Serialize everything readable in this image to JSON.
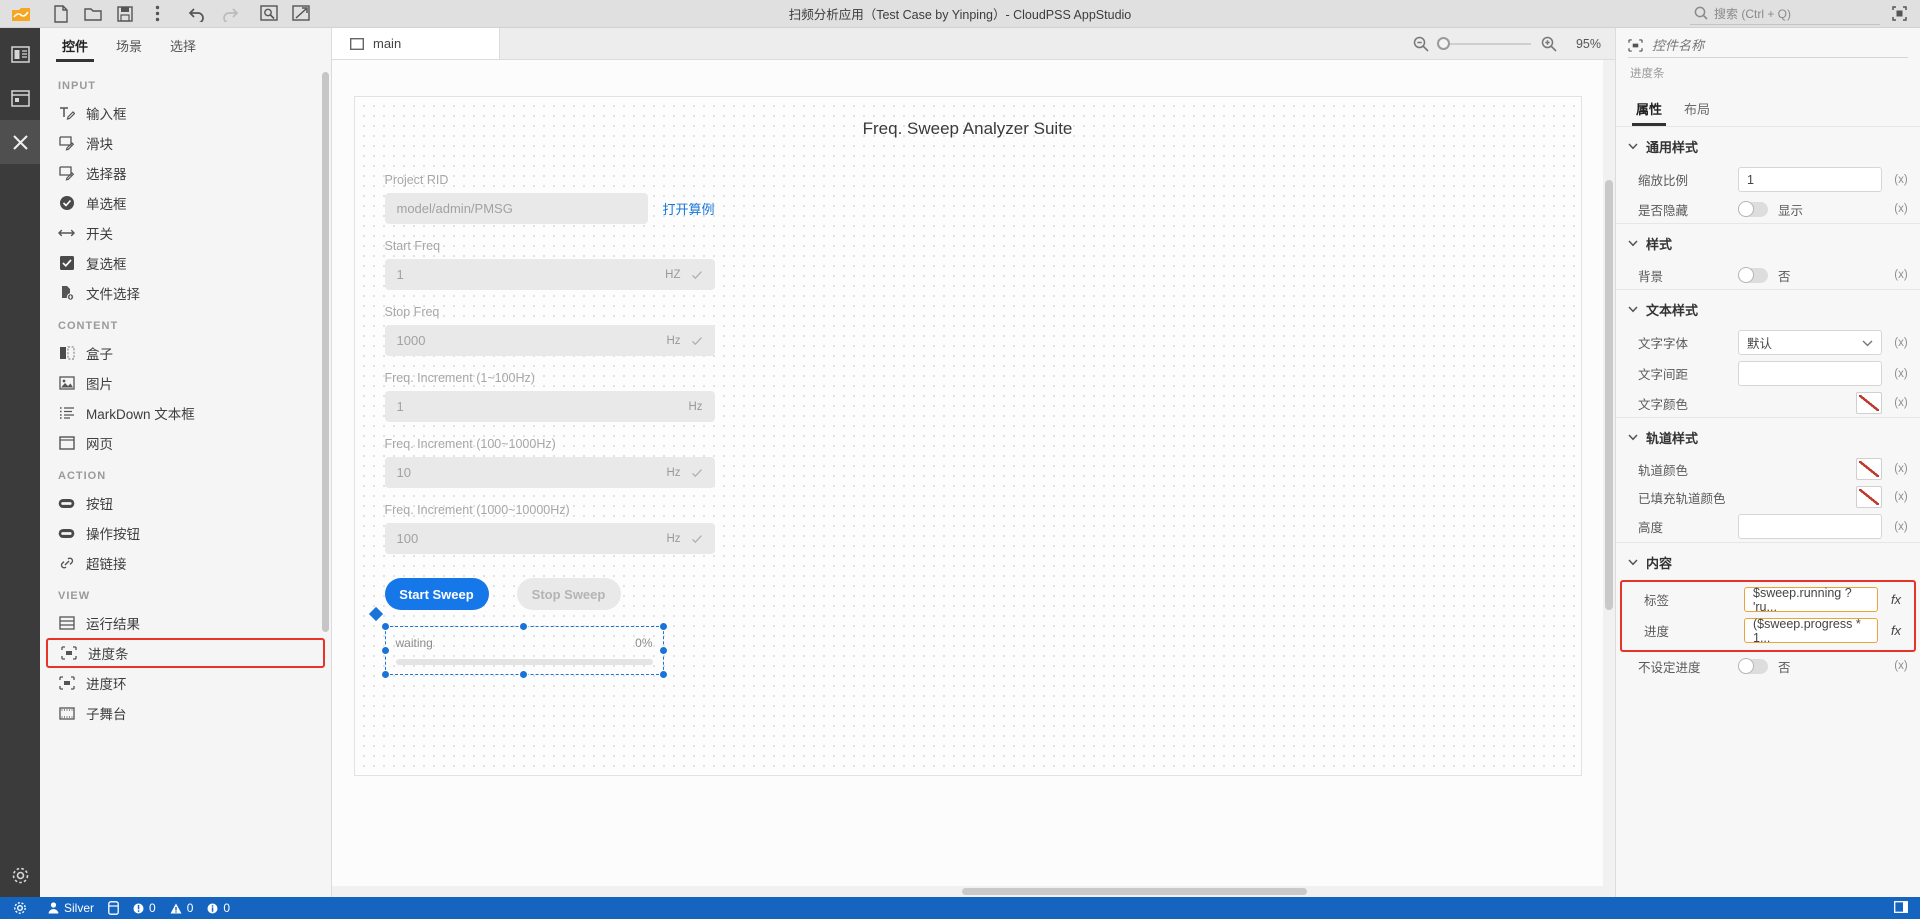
{
  "titlebar": {
    "app_title": "扫频分析应用（Test Case by Yinping）- CloudPSS AppStudio",
    "search_placeholder": "搜索 (Ctrl + Q)",
    "tools": [
      {
        "name": "app-logo-icon",
        "label": "CloudPSS"
      },
      {
        "name": "new-file-icon",
        "label": "新建"
      },
      {
        "name": "open-folder-icon",
        "label": "打开"
      },
      {
        "name": "save-icon",
        "label": "保存"
      },
      {
        "name": "more-options-icon",
        "label": "更多"
      },
      {
        "name": "undo-icon",
        "label": "撤销"
      },
      {
        "name": "redo-icon",
        "label": "重做"
      },
      {
        "name": "preview-icon",
        "label": "预览"
      },
      {
        "name": "publish-icon",
        "label": "发布"
      }
    ]
  },
  "rail": {
    "items": [
      {
        "name": "rail-layout",
        "label": "布局"
      },
      {
        "name": "rail-resources",
        "label": "资源"
      },
      {
        "name": "rail-tools",
        "label": "工具"
      },
      {
        "name": "rail-settings",
        "label": "设置"
      }
    ]
  },
  "leftpanel": {
    "tabs": [
      {
        "label": "控件",
        "active": true
      },
      {
        "label": "场景",
        "active": false
      },
      {
        "label": "选择",
        "active": false
      }
    ],
    "groups": [
      {
        "title": "INPUT",
        "items": [
          {
            "label": "输入框",
            "icon": "text-input-icon"
          },
          {
            "label": "滑块",
            "icon": "slider-icon"
          },
          {
            "label": "选择器",
            "icon": "selector-icon"
          },
          {
            "label": "单选框",
            "icon": "radio-icon"
          },
          {
            "label": "开关",
            "icon": "switch-icon"
          },
          {
            "label": "复选框",
            "icon": "checkbox-icon"
          },
          {
            "label": "文件选择",
            "icon": "file-picker-icon"
          }
        ]
      },
      {
        "title": "CONTENT",
        "items": [
          {
            "label": "盒子",
            "icon": "box-icon"
          },
          {
            "label": "图片",
            "icon": "image-icon"
          },
          {
            "label": "MarkDown 文本框",
            "icon": "markdown-icon"
          },
          {
            "label": "网页",
            "icon": "webpage-icon"
          }
        ]
      },
      {
        "title": "ACTION",
        "items": [
          {
            "label": "按钮",
            "icon": "button-icon"
          },
          {
            "label": "操作按钮",
            "icon": "action-button-icon"
          },
          {
            "label": "超链接",
            "icon": "hyperlink-icon"
          }
        ]
      },
      {
        "title": "VIEW",
        "items": [
          {
            "label": "运行结果",
            "icon": "result-icon",
            "highlight": false
          },
          {
            "label": "进度条",
            "icon": "progress-bar-icon",
            "highlight": true
          },
          {
            "label": "进度环",
            "icon": "progress-ring-icon",
            "highlight": false
          },
          {
            "label": "子舞台",
            "icon": "sub-stage-icon",
            "highlight": false
          }
        ]
      }
    ]
  },
  "center": {
    "document_tab": "main",
    "zoom_label": "95%",
    "stage_title": "Freq. Sweep Analyzer Suite",
    "form": [
      {
        "label": "Project RID",
        "value": "model/admin/PMSG",
        "unit": "",
        "check": false,
        "link": "打开算例"
      },
      {
        "label": "Start Freq",
        "value": "1",
        "unit": "HZ",
        "check": true,
        "link": ""
      },
      {
        "label": "Stop Freq",
        "value": "1000",
        "unit": "Hz",
        "check": true,
        "link": ""
      },
      {
        "label": "Freq. Increment (1~100Hz)",
        "value": "1",
        "unit": "Hz",
        "check": false,
        "link": ""
      },
      {
        "label": "Freq. Increment (100~1000Hz)",
        "value": "10",
        "unit": "Hz",
        "check": true,
        "link": ""
      },
      {
        "label": "Freq. Increment (1000~10000Hz)",
        "value": "100",
        "unit": "Hz",
        "check": true,
        "link": ""
      }
    ],
    "buttons": {
      "start": "Start Sweep",
      "stop": "Stop Sweep"
    },
    "progress_widget": {
      "label": "waiting",
      "percent": "0%"
    }
  },
  "rightpanel": {
    "name_placeholder": "控件名称",
    "widget_type": "进度条",
    "tabs": [
      {
        "label": "属性",
        "active": true
      },
      {
        "label": "布局",
        "active": false
      }
    ],
    "sections": [
      {
        "title": "通用样式",
        "rows": [
          {
            "label": "缩放比例",
            "type": "input",
            "value": "1",
            "suffix": "(x)"
          },
          {
            "label": "是否隐藏",
            "type": "toggle",
            "value": "显示",
            "suffix": "(x)"
          }
        ]
      },
      {
        "title": "样式",
        "rows": [
          {
            "label": "背景",
            "type": "toggle",
            "value": "否",
            "suffix": "(x)"
          }
        ]
      },
      {
        "title": "文本样式",
        "rows": [
          {
            "label": "文字字体",
            "type": "select",
            "value": "默认",
            "suffix": "(x)"
          },
          {
            "label": "文字间距",
            "type": "input",
            "value": "",
            "suffix": "(x)"
          },
          {
            "label": "文字颜色",
            "type": "color",
            "value": "",
            "suffix": "(x)"
          }
        ]
      },
      {
        "title": "轨道样式",
        "rows": [
          {
            "label": "轨道颜色",
            "type": "color",
            "value": "",
            "suffix": "(x)"
          },
          {
            "label": "已填充轨道颜色",
            "type": "color",
            "value": "",
            "suffix": "(x)"
          },
          {
            "label": "高度",
            "type": "input",
            "value": "",
            "suffix": "(x)"
          }
        ]
      },
      {
        "title": "内容",
        "rows": [
          {
            "label": "标签",
            "type": "formula",
            "value": "$sweep.running ? 'ru...",
            "suffix": "fx"
          },
          {
            "label": "进度",
            "type": "formula",
            "value": "($sweep.progress * 1...",
            "suffix": "fx"
          },
          {
            "label": "不设定进度",
            "type": "toggle",
            "value": "否",
            "suffix": "(x)"
          }
        ]
      }
    ]
  },
  "statusbar": {
    "user": "Silver",
    "errors": "0",
    "warnings": "0",
    "infos": "0"
  },
  "colors": {
    "accent_blue": "#1677e8",
    "status_blue": "#1464c0",
    "highlight_red": "#e8332a",
    "formula_orange": "#e8a33d"
  }
}
